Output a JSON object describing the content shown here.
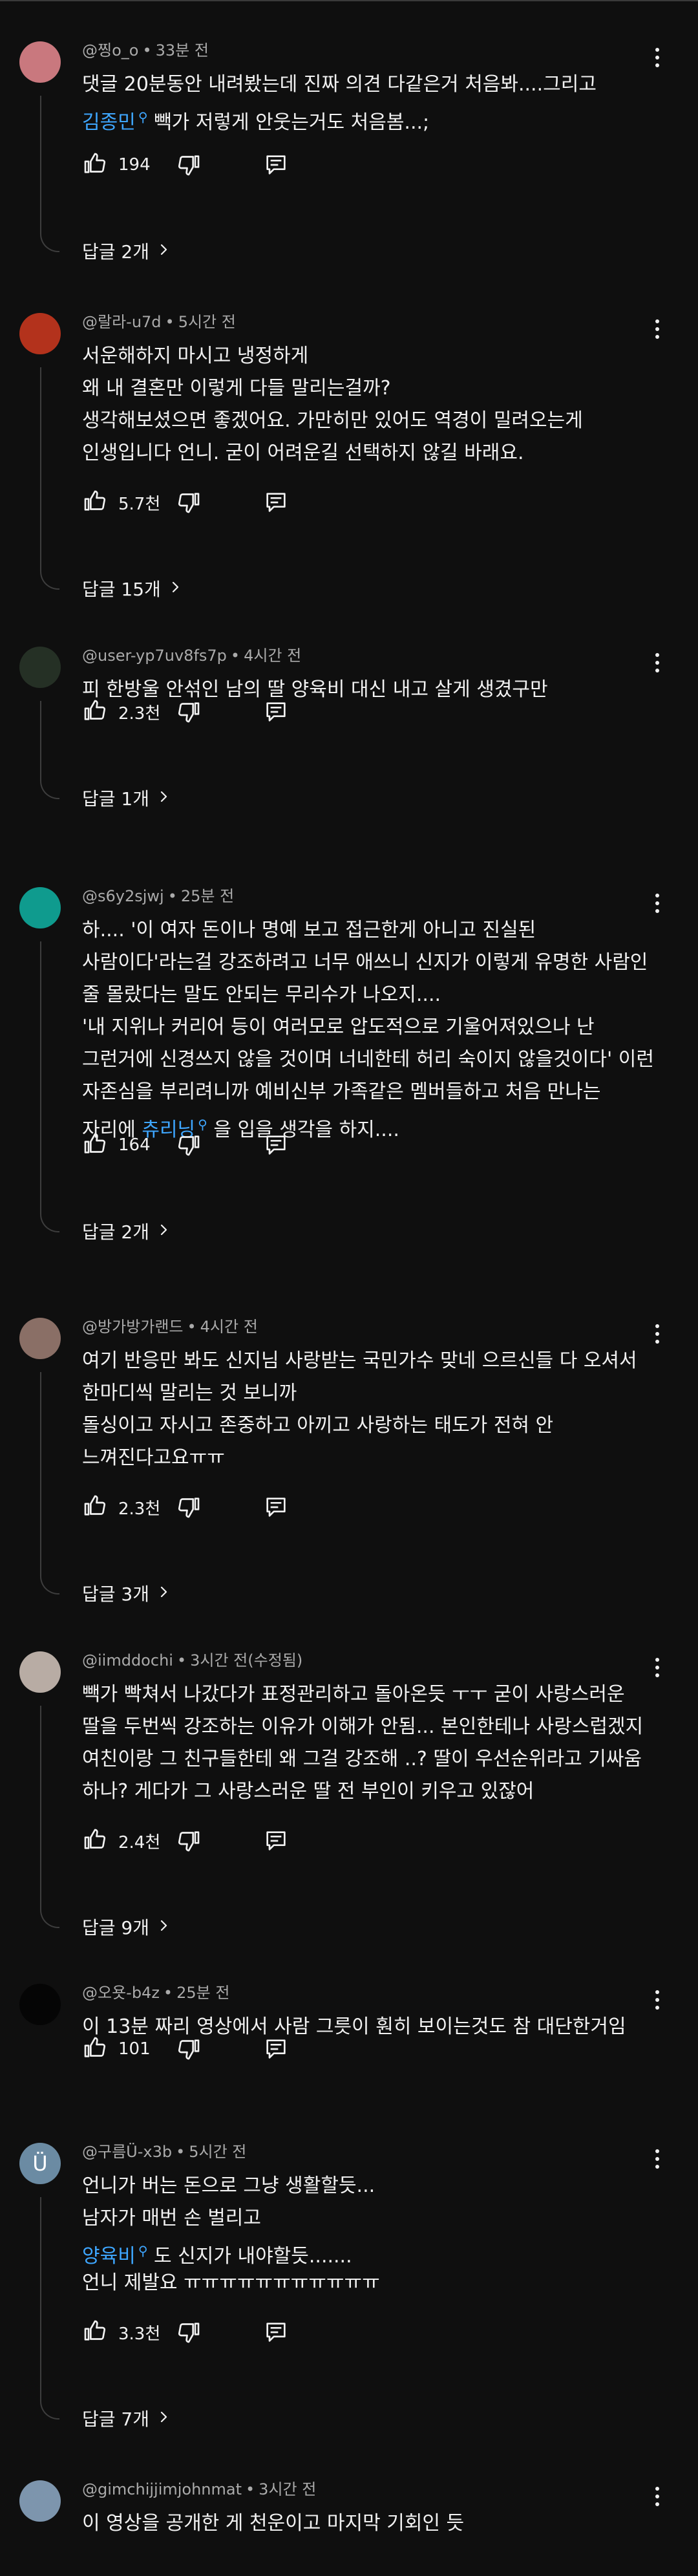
{
  "comments": [
    {
      "author": "@찡o_o",
      "time": "33분 전",
      "avatar_color": "#c9787e",
      "avatar_letter": "",
      "lines": [
        [
          {
            "t": "댓글 20분동안 내려봤는데 진짜 의견 다같은거 처음봐....그리고"
          }
        ],
        [
          {
            "t": "김종민",
            "m": true
          },
          {
            "t": " 빽가 저렇게 안웃는거도 처음봄...;"
          }
        ]
      ],
      "likes": "194",
      "replies": "답글 2개"
    },
    {
      "author": "@랄라-u7d",
      "time": "5시간 전",
      "avatar_color": "#b3321c",
      "avatar_letter": "",
      "lines": [
        [
          {
            "t": "서운해하지 마시고 냉정하게"
          }
        ],
        [
          {
            "t": "왜 내 결혼만 이렇게 다들 말리는걸까?"
          }
        ],
        [
          {
            "t": "생각해보셨으면 좋겠어요. 가만히만 있어도 역경이 밀려오는게"
          }
        ],
        [
          {
            "t": "인생입니다 언니. 굳이 어려운길 선택하지 않길 바래요."
          }
        ]
      ],
      "likes": "5.7천",
      "replies": "답글 15개"
    },
    {
      "author": "@user-yp7uv8fs7p",
      "time": "4시간 전",
      "avatar_color": "#253025",
      "avatar_letter": "",
      "lines": [
        [
          {
            "t": "피 한방울 안섞인 남의 딸 양육비 대신 내고 살게 생겼구만"
          }
        ]
      ],
      "likes": "2.3천",
      "replies": "답글 1개"
    },
    {
      "author": "@s6y2sjwj",
      "time": "25분 전",
      "avatar_color": "#0f9b8e",
      "avatar_letter": "",
      "lines": [
        [
          {
            "t": "하.... '이 여자 돈이나 명예 보고 접근한게 아니고 진실된"
          }
        ],
        [
          {
            "t": "사람이다'라는걸 강조하려고 너무 애쓰니 신지가 이렇게 유명한 사람인"
          }
        ],
        [
          {
            "t": "줄 몰랐다는 말도 안되는 무리수가 나오지...."
          }
        ],
        [
          {
            "t": "'내 지위나 커리어 등이 여러모로 압도적으로 기울어져있으나 난"
          }
        ],
        [
          {
            "t": "그런거에 신경쓰지 않을 것이며 너네한테 허리 숙이지 않을것이다' 이런"
          }
        ],
        [
          {
            "t": "자존심을 부리려니까 예비신부 가족같은 멤버들하고 처음 만나는"
          }
        ],
        [
          {
            "t": "자리에 "
          },
          {
            "t": "츄리닝",
            "m": true
          },
          {
            "t": " 을 입을 생각을 하지...."
          }
        ]
      ],
      "likes": "164",
      "replies": "답글 2개"
    },
    {
      "author": "@방가방가랜드",
      "time": "4시간 전",
      "avatar_color": "#8a6f66",
      "avatar_letter": "",
      "lines": [
        [
          {
            "t": "여기 반응만 봐도 신지님 사랑받는 국민가수 맞네 으르신들 다 오셔서"
          }
        ],
        [
          {
            "t": "한마디씩 말리는 것 보니까"
          }
        ],
        [
          {
            "t": "돌싱이고 자시고 존중하고 아끼고 사랑하는 태도가 전혀 안"
          }
        ],
        [
          {
            "t": "느껴진다고요ㅠㅠ"
          }
        ]
      ],
      "likes": "2.3천",
      "replies": "답글 3개"
    },
    {
      "author": "@iimddochi",
      "time": "3시간 전(수정됨)",
      "avatar_color": "#b8aca4",
      "avatar_letter": "",
      "lines": [
        [
          {
            "t": "빽가 빡쳐서 나갔다가 표정관리하고 돌아온듯 ㅜㅜ 굳이 사랑스러운"
          }
        ],
        [
          {
            "t": "딸을 두번씩 강조하는 이유가 이해가 안됨... 본인한테나 사랑스럽겠지"
          }
        ],
        [
          {
            "t": "여친이랑 그 친구들한테 왜 그걸 강조해 ..? 딸이 우선순위라고 기싸움"
          }
        ],
        [
          {
            "t": "하나? 게다가 그 사랑스러운 딸 전 부인이 키우고 있잖어"
          }
        ]
      ],
      "likes": "2.4천",
      "replies": "답글 9개"
    },
    {
      "author": "@오욧-b4z",
      "time": "25분 전",
      "avatar_color": "#050505",
      "avatar_letter": "",
      "lines": [
        [
          {
            "t": "이 13분 짜리 영상에서 사람 그릇이 훤히 보이는것도 참 대단한거임"
          }
        ]
      ],
      "likes": "101",
      "replies": ""
    },
    {
      "author": "@구름Ü-x3b",
      "time": "5시간 전",
      "avatar_color": "#6b8ba3",
      "avatar_letter": "Ü",
      "lines": [
        [
          {
            "t": "언니가 버는 돈으로 그냥 생활할듯..."
          }
        ],
        [
          {
            "t": "남자가 매번 손 벌리고"
          }
        ],
        [
          {
            "t": "양육비",
            "m": true
          },
          {
            "t": " 도 신지가 내야할듯......."
          }
        ],
        [
          {
            "t": "언니 제발요 ㅠㅠㅠㅠㅠㅠㅠㅠㅠㅠㅠ"
          }
        ]
      ],
      "likes": "3.3천",
      "replies": "답글 7개"
    },
    {
      "author": "@gimchijjimjohnmat",
      "time": "3시간 전",
      "avatar_color": "#7d95ad",
      "avatar_letter": "",
      "lines": [
        [
          {
            "t": "이 영상을 공개한 게 천운이고 마지막 기회인 듯"
          }
        ]
      ],
      "likes": "",
      "replies": ""
    }
  ]
}
